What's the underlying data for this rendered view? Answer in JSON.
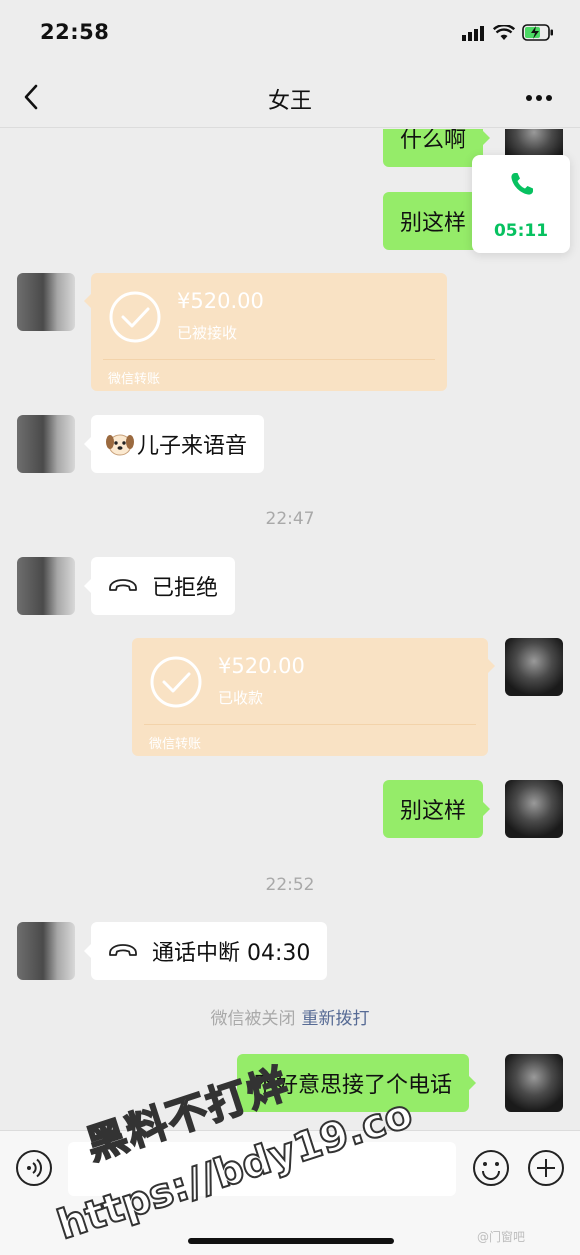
{
  "status_bar": {
    "time": "22:58"
  },
  "nav": {
    "title": "女王"
  },
  "floating_call": {
    "duration": "05:11"
  },
  "messages": {
    "m1_text": "什么啊",
    "m2_text": "别这样",
    "m3_amount": "¥520.00",
    "m3_status": "已被接收",
    "m3_label": "微信转账",
    "m4_text": "儿子来语音",
    "ts1": "22:47",
    "m5_text": "已拒绝",
    "m6_amount": "¥520.00",
    "m6_status": "已收款",
    "m6_label": "微信转账",
    "m7_text": "别这样",
    "ts2": "22:52",
    "m8_text": "通话中断 04:30",
    "sys_text": "微信被关闭",
    "sys_link": "重新拨打",
    "m9_text": "不好意思接了个电话"
  },
  "watermark": {
    "title": "黑料不打烊",
    "url": "https://bdy19.co",
    "corner": "@门窗吧"
  },
  "colors": {
    "accent_green": "#07c160",
    "bubble_green": "#95ec69",
    "transfer_bg": "#f9e2c4",
    "link_blue": "#576b95"
  }
}
